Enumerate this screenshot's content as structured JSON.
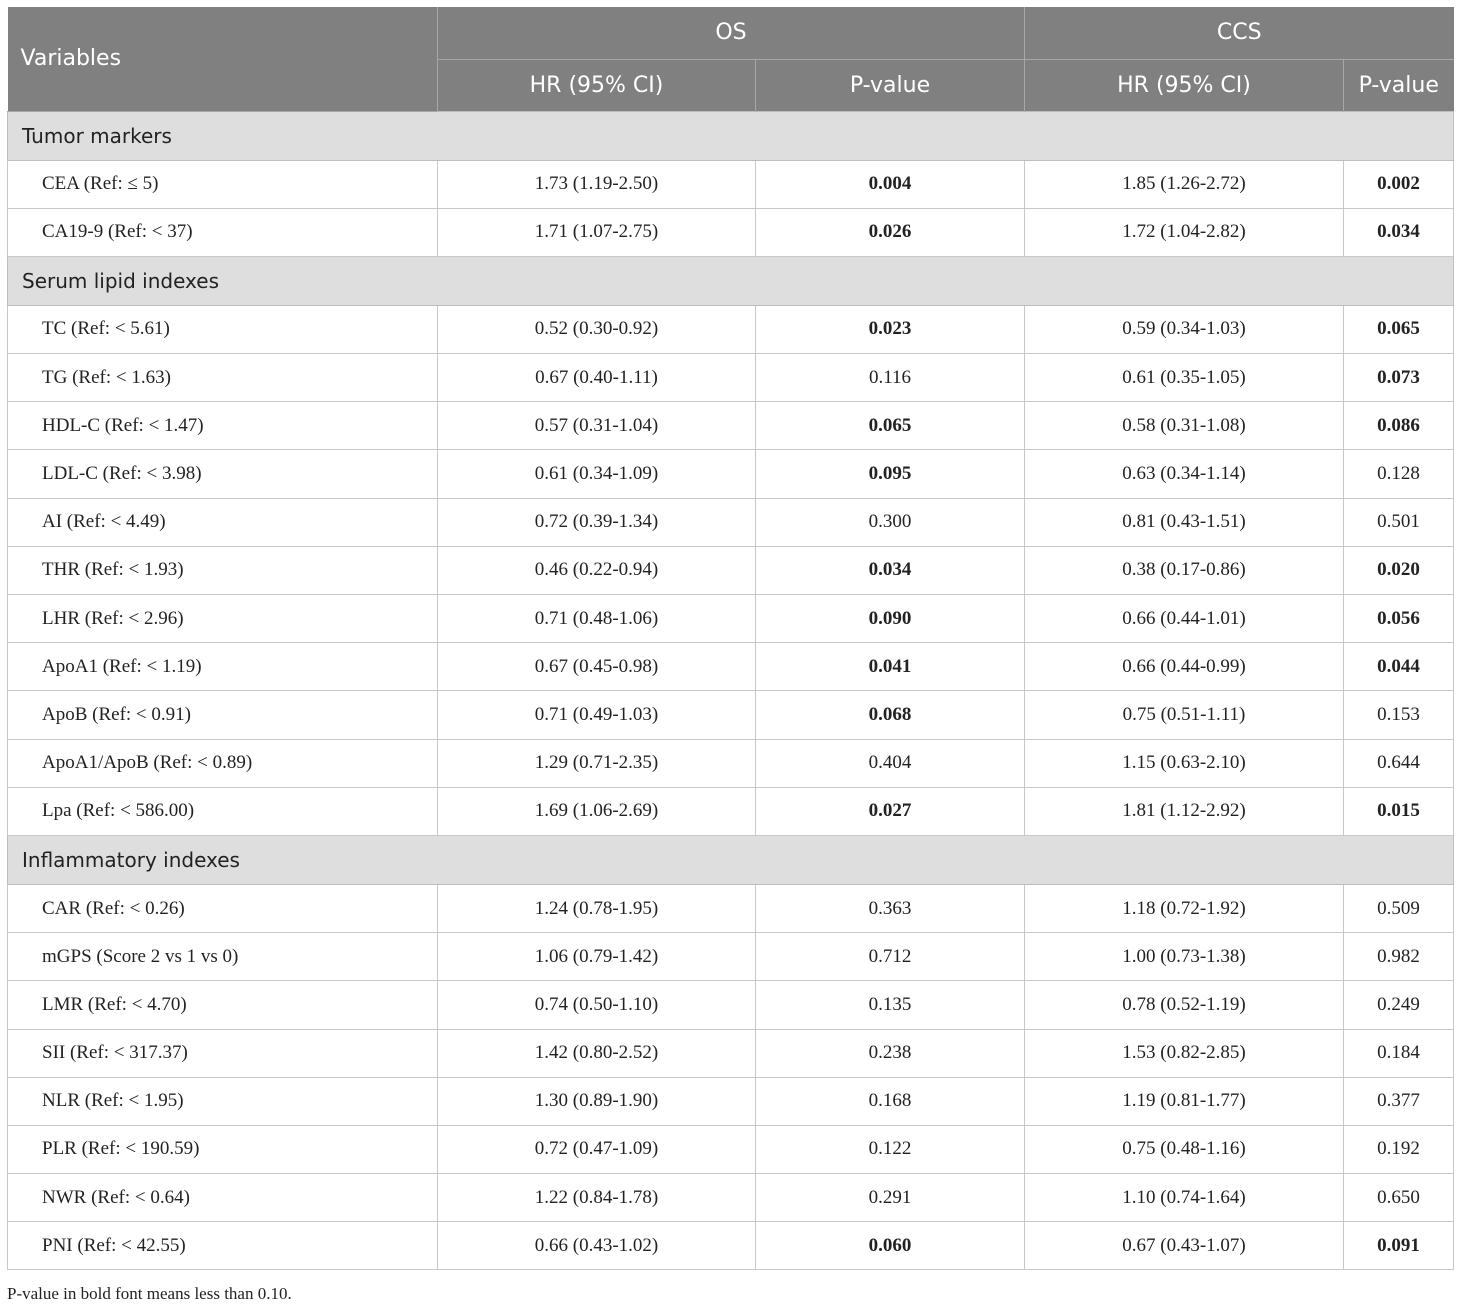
{
  "header": {
    "variables": "Variables",
    "os": "OS",
    "ccs": "CCS",
    "hr": "HR (95% CI)",
    "pvalue": "P-value"
  },
  "sections": [
    {
      "title": "Tumor markers",
      "rows": [
        {
          "var": "CEA (Ref: ≤ 5)",
          "os_hr": "1.73 (1.19-2.50)",
          "os_p": "0.004",
          "os_bold": true,
          "ccs_hr": "1.85 (1.26-2.72)",
          "ccs_p": "0.002",
          "ccs_bold": true
        },
        {
          "var": "CA19-9 (Ref: < 37)",
          "os_hr": "1.71 (1.07-2.75)",
          "os_p": "0.026",
          "os_bold": true,
          "ccs_hr": "1.72 (1.04-2.82)",
          "ccs_p": "0.034",
          "ccs_bold": true
        }
      ]
    },
    {
      "title": "Serum lipid indexes",
      "rows": [
        {
          "var": "TC (Ref: < 5.61)",
          "os_hr": "0.52 (0.30-0.92)",
          "os_p": "0.023",
          "os_bold": true,
          "ccs_hr": "0.59 (0.34-1.03)",
          "ccs_p": "0.065",
          "ccs_bold": true
        },
        {
          "var": "TG (Ref: < 1.63)",
          "os_hr": "0.67 (0.40-1.11)",
          "os_p": "0.116",
          "os_bold": false,
          "ccs_hr": "0.61 (0.35-1.05)",
          "ccs_p": "0.073",
          "ccs_bold": true
        },
        {
          "var": "HDL-C (Ref: < 1.47)",
          "os_hr": "0.57 (0.31-1.04)",
          "os_p": "0.065",
          "os_bold": true,
          "ccs_hr": "0.58 (0.31-1.08)",
          "ccs_p": "0.086",
          "ccs_bold": true
        },
        {
          "var": "LDL-C (Ref: < 3.98)",
          "os_hr": "0.61 (0.34-1.09)",
          "os_p": "0.095",
          "os_bold": true,
          "ccs_hr": "0.63 (0.34-1.14)",
          "ccs_p": "0.128",
          "ccs_bold": false
        },
        {
          "var": "AI (Ref: < 4.49)",
          "os_hr": "0.72 (0.39-1.34)",
          "os_p": "0.300",
          "os_bold": false,
          "ccs_hr": "0.81 (0.43-1.51)",
          "ccs_p": "0.501",
          "ccs_bold": false
        },
        {
          "var": "THR (Ref: < 1.93)",
          "os_hr": "0.46 (0.22-0.94)",
          "os_p": "0.034",
          "os_bold": true,
          "ccs_hr": "0.38 (0.17-0.86)",
          "ccs_p": "0.020",
          "ccs_bold": true
        },
        {
          "var": "LHR (Ref: < 2.96)",
          "os_hr": "0.71 (0.48-1.06)",
          "os_p": "0.090",
          "os_bold": true,
          "ccs_hr": "0.66 (0.44-1.01)",
          "ccs_p": "0.056",
          "ccs_bold": true
        },
        {
          "var": "ApoA1 (Ref: < 1.19)",
          "os_hr": "0.67 (0.45-0.98)",
          "os_p": "0.041",
          "os_bold": true,
          "ccs_hr": "0.66 (0.44-0.99)",
          "ccs_p": "0.044",
          "ccs_bold": true
        },
        {
          "var": "ApoB (Ref: < 0.91)",
          "os_hr": "0.71 (0.49-1.03)",
          "os_p": "0.068",
          "os_bold": true,
          "ccs_hr": "0.75 (0.51-1.11)",
          "ccs_p": "0.153",
          "ccs_bold": false
        },
        {
          "var": "ApoA1/ApoB (Ref: < 0.89)",
          "os_hr": "1.29 (0.71-2.35)",
          "os_p": "0.404",
          "os_bold": false,
          "ccs_hr": "1.15 (0.63-2.10)",
          "ccs_p": "0.644",
          "ccs_bold": false
        },
        {
          "var": "Lpa (Ref: < 586.00)",
          "os_hr": "1.69 (1.06-2.69)",
          "os_p": "0.027",
          "os_bold": true,
          "ccs_hr": "1.81 (1.12-2.92)",
          "ccs_p": "0.015",
          "ccs_bold": true
        }
      ]
    },
    {
      "title": "Inflammatory indexes",
      "rows": [
        {
          "var": "CAR (Ref: < 0.26)",
          "os_hr": "1.24 (0.78-1.95)",
          "os_p": "0.363",
          "os_bold": false,
          "ccs_hr": "1.18 (0.72-1.92)",
          "ccs_p": "0.509",
          "ccs_bold": false
        },
        {
          "var": "mGPS (Score 2 vs 1 vs 0)",
          "os_hr": "1.06 (0.79-1.42)",
          "os_p": "0.712",
          "os_bold": false,
          "ccs_hr": "1.00 (0.73-1.38)",
          "ccs_p": "0.982",
          "ccs_bold": false
        },
        {
          "var": "LMR (Ref: < 4.70)",
          "os_hr": "0.74 (0.50-1.10)",
          "os_p": "0.135",
          "os_bold": false,
          "ccs_hr": "0.78 (0.52-1.19)",
          "ccs_p": "0.249",
          "ccs_bold": false
        },
        {
          "var": "SII (Ref: < 317.37)",
          "os_hr": "1.42 (0.80-2.52)",
          "os_p": "0.238",
          "os_bold": false,
          "ccs_hr": "1.53 (0.82-2.85)",
          "ccs_p": "0.184",
          "ccs_bold": false
        },
        {
          "var": "NLR (Ref: < 1.95)",
          "os_hr": "1.30 (0.89-1.90)",
          "os_p": "0.168",
          "os_bold": false,
          "ccs_hr": "1.19 (0.81-1.77)",
          "ccs_p": "0.377",
          "ccs_bold": false
        },
        {
          "var": "PLR (Ref: < 190.59)",
          "os_hr": "0.72 (0.47-1.09)",
          "os_p": "0.122",
          "os_bold": false,
          "ccs_hr": "0.75 (0.48-1.16)",
          "ccs_p": "0.192",
          "ccs_bold": false
        },
        {
          "var": "NWR (Ref: < 0.64)",
          "os_hr": "1.22 (0.84-1.78)",
          "os_p": "0.291",
          "os_bold": false,
          "ccs_hr": "1.10 (0.74-1.64)",
          "ccs_p": "0.650",
          "ccs_bold": false
        },
        {
          "var": "PNI (Ref: < 42.55)",
          "os_hr": "0.66 (0.43-1.02)",
          "os_p": "0.060",
          "os_bold": true,
          "ccs_hr": "0.67 (0.43-1.07)",
          "ccs_p": "0.091",
          "ccs_bold": true
        }
      ]
    }
  ],
  "footnote": "P-value in bold font means less than 0.10."
}
